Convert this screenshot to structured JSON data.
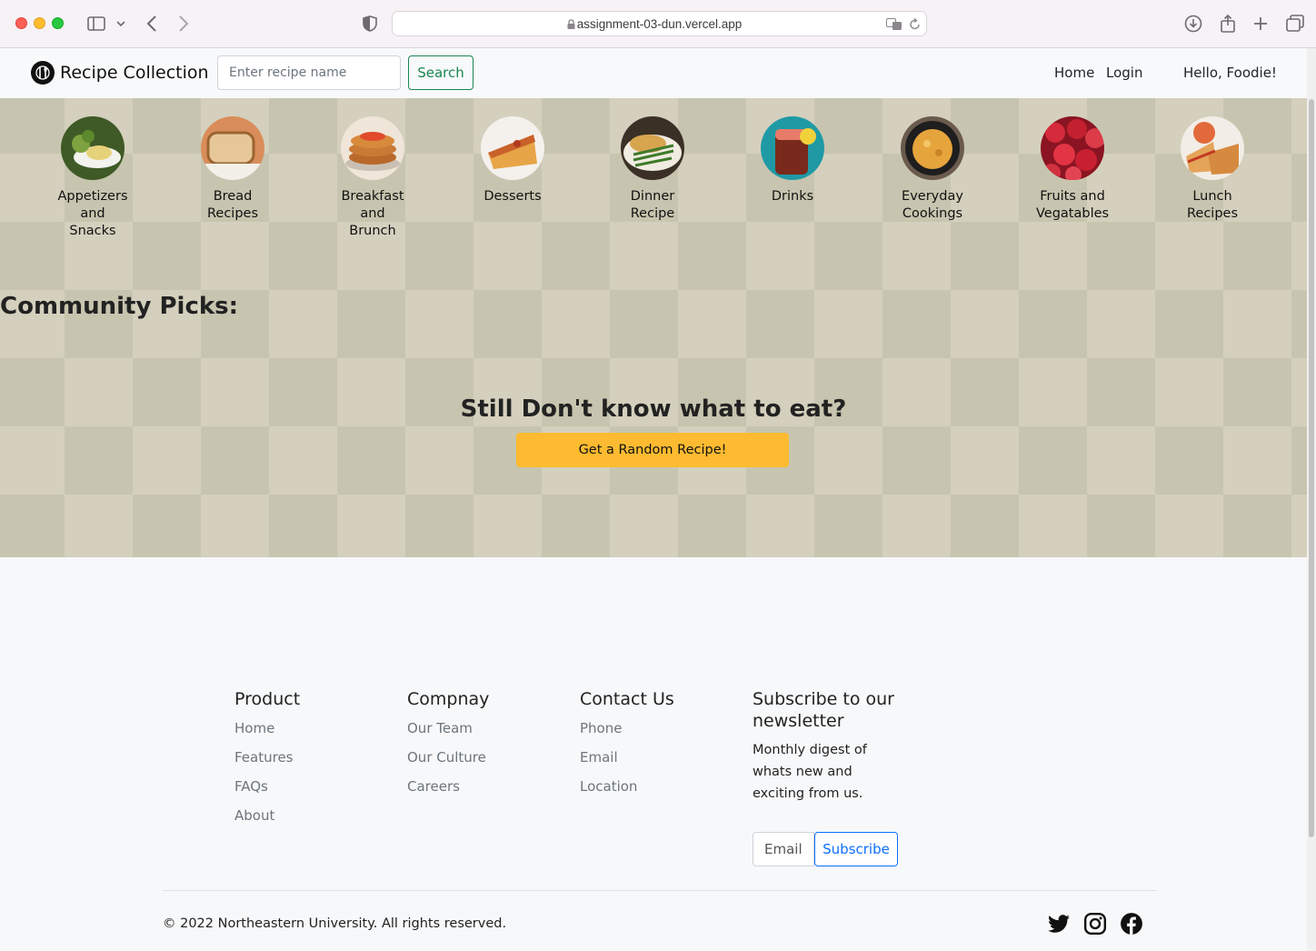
{
  "browser": {
    "url": "assignment-03-dun.vercel.app"
  },
  "navbar": {
    "brand": "Recipe Collection",
    "search_placeholder": "Enter recipe name",
    "search_label": "Search",
    "home": "Home",
    "login": "Login",
    "greeting": "Hello, Foodie!"
  },
  "categories": [
    {
      "label": "Appetizers and Snacks",
      "icon": "appetizer-photo",
      "color": "#6b8f3a"
    },
    {
      "label": "Bread Recipes",
      "icon": "bread-photo",
      "color": "#c58a4a"
    },
    {
      "label": "Breakfast and Brunch",
      "icon": "pancake-photo",
      "color": "#b86a2e"
    },
    {
      "label": "Desserts",
      "icon": "dessert-photo",
      "color": "#d98a3c"
    },
    {
      "label": "Dinner Recipe",
      "icon": "dinner-photo",
      "color": "#5f7a3a"
    },
    {
      "label": "Drinks",
      "icon": "drink-photo",
      "color": "#2aa3a8"
    },
    {
      "label": "Everyday Cookings",
      "icon": "skillet-photo",
      "color": "#d9a03a"
    },
    {
      "label": "Fruits and Vegatables",
      "icon": "apples-photo",
      "color": "#c42a3a"
    },
    {
      "label": "Lunch Recipes",
      "icon": "sandwich-photo",
      "color": "#d4843e"
    }
  ],
  "community": {
    "title": "Community Picks:"
  },
  "random": {
    "title": "Still Don't know what to eat?",
    "button": "Get a Random Recipe!"
  },
  "footer": {
    "product": {
      "title": "Product",
      "links": [
        "Home",
        "Features",
        "FAQs",
        "About"
      ]
    },
    "company": {
      "title": "Compnay",
      "links": [
        "Our Team",
        "Our Culture",
        "Careers"
      ]
    },
    "contact": {
      "title": "Contact Us",
      "links": [
        "Phone",
        "Email",
        "Location"
      ]
    },
    "newsletter": {
      "title": "Subscribe to our newsletter",
      "text": "Monthly digest of whats new and exciting from us.",
      "email_placeholder": "Email",
      "button": "Subscribe"
    },
    "copyright": "© 2022 Northeastern University. All rights reserved.",
    "social": [
      "twitter-icon",
      "instagram-icon",
      "facebook-icon"
    ]
  }
}
